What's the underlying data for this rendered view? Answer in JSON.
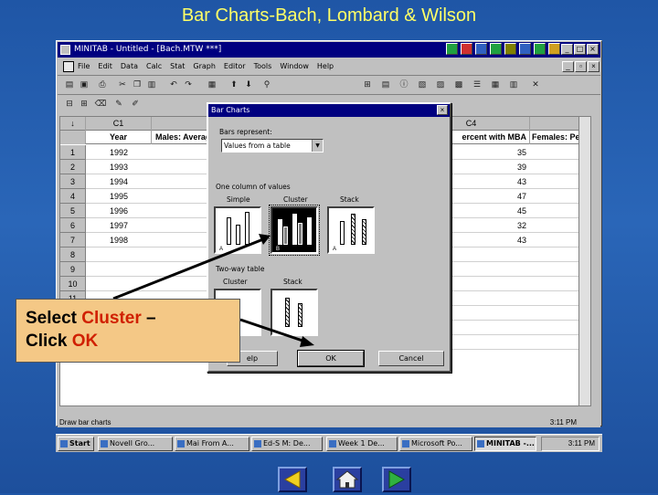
{
  "slide_title": "Bar Charts-Bach, Lombard & Wilson",
  "window": {
    "title": "MINITAB - Untitled - [Bach.MTW ***]",
    "menus": [
      "File",
      "Edit",
      "Data",
      "Calc",
      "Stat",
      "Graph",
      "Editor",
      "Tools",
      "Window",
      "Help"
    ]
  },
  "worksheet": {
    "columns": [
      {
        "id": "C1",
        "name": "Year"
      },
      {
        "id": "C2",
        "name": "Males: Average St"
      },
      {
        "id": "C4",
        "name": "ercent with MBA"
      },
      {
        "id": "C5",
        "name": "Females: Perc"
      }
    ],
    "rows": [
      {
        "n": "1",
        "year": "1992",
        "c4": "35"
      },
      {
        "n": "2",
        "year": "1993",
        "c4": "39"
      },
      {
        "n": "3",
        "year": "1994",
        "c4": "43"
      },
      {
        "n": "4",
        "year": "1995",
        "c4": "47"
      },
      {
        "n": "5",
        "year": "1996",
        "c4": "45"
      },
      {
        "n": "6",
        "year": "1997",
        "c4": "32"
      },
      {
        "n": "7",
        "year": "1998",
        "c4": "43"
      },
      {
        "n": "8",
        "year": "",
        "c4": ""
      },
      {
        "n": "9",
        "year": "",
        "c4": ""
      },
      {
        "n": "10",
        "year": "",
        "c4": ""
      },
      {
        "n": "11",
        "year": "",
        "c4": ""
      },
      {
        "n": "16",
        "year": "",
        "c4": ""
      },
      {
        "n": "17",
        "year": "",
        "c4": ""
      },
      {
        "n": "18",
        "year": "",
        "c4": ""
      }
    ],
    "header_symbol": "↓"
  },
  "status": {
    "text": "Draw bar charts",
    "time": "3:11 PM"
  },
  "dialog": {
    "title": "Bar Charts",
    "represent_label": "Bars represent:",
    "represent_value": "Values from a table",
    "section1": "One column of values",
    "option_simple": "Simple",
    "option_cluster": "Cluster",
    "option_stack": "Stack",
    "section2": "Two-way table",
    "option2_cluster": "Cluster",
    "option2_stack": "Stack",
    "help_label": "elp",
    "ok_label": "OK",
    "cancel_label": "Cancel"
  },
  "callout": {
    "line1_a": "Select ",
    "line1_b": "Cluster",
    "line1_c": " –",
    "line2_a": "Click ",
    "line2_b": "OK"
  },
  "taskbar": {
    "start": "Start",
    "tasks": [
      "Novell Gro...",
      "Mai From A...",
      "Ed-S M: De...",
      "Week 1 De...",
      "Microsoft Po...",
      "MINITAB -..."
    ],
    "clock": "3:11 PM"
  },
  "nav": {
    "prev": "previous",
    "home": "home",
    "next": "next"
  }
}
